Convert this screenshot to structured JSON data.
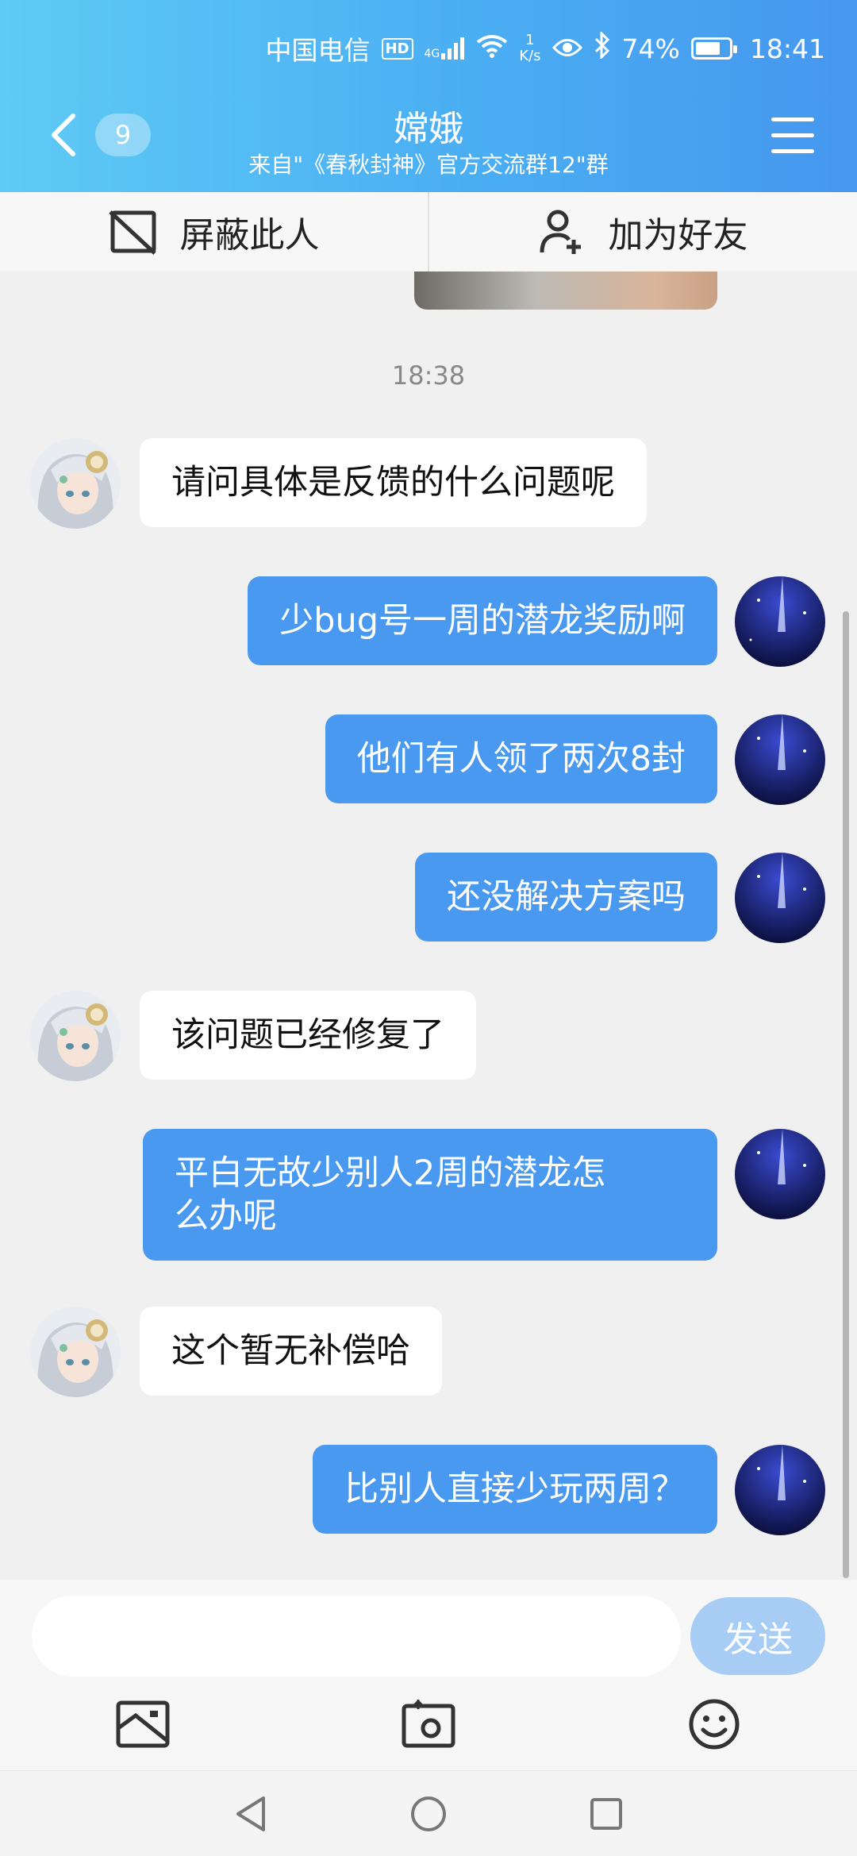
{
  "status": {
    "carrier": "中国电信",
    "hd": "HD",
    "network": "4G",
    "speed_value": "1",
    "speed_unit": "K/s",
    "battery": "74%",
    "battery_level": 0.74,
    "time": "18:41"
  },
  "header": {
    "unread_count": "9",
    "title": "嫦娥",
    "subtitle": "来自\"《春秋封神》官方交流群12\"群"
  },
  "actions": {
    "block": "屏蔽此人",
    "add_friend": "加为好友"
  },
  "chat": {
    "timestamp": "18:38",
    "messages": [
      {
        "side": "in",
        "text": "请问具体是反馈的什么问题呢"
      },
      {
        "side": "out",
        "text": "少bug号一周的潜龙奖励啊"
      },
      {
        "side": "out",
        "text": "他们有人领了两次8封"
      },
      {
        "side": "out",
        "text": "还没解决方案吗"
      },
      {
        "side": "in",
        "text": "该问题已经修复了"
      },
      {
        "side": "out",
        "text": "平白无故少别人2周的潜龙怎\n么办呢"
      },
      {
        "side": "in",
        "text": "这个暂无补偿哈"
      },
      {
        "side": "out",
        "text": "比别人直接少玩两周？"
      }
    ]
  },
  "composer": {
    "placeholder": "",
    "send_label": "发送"
  },
  "colors": {
    "header_start": "#5fcaf5",
    "header_end": "#4697ef",
    "outgoing_bubble": "#4a99f0",
    "incoming_bubble": "#ffffff",
    "send_disabled": "#a7cdf4"
  },
  "icons": [
    "back-chevron-icon",
    "menu-icon",
    "block-user-icon",
    "add-friend-icon",
    "image-icon",
    "camera-icon",
    "emoji-icon",
    "nav-back-icon",
    "nav-home-icon",
    "nav-recents-icon"
  ]
}
